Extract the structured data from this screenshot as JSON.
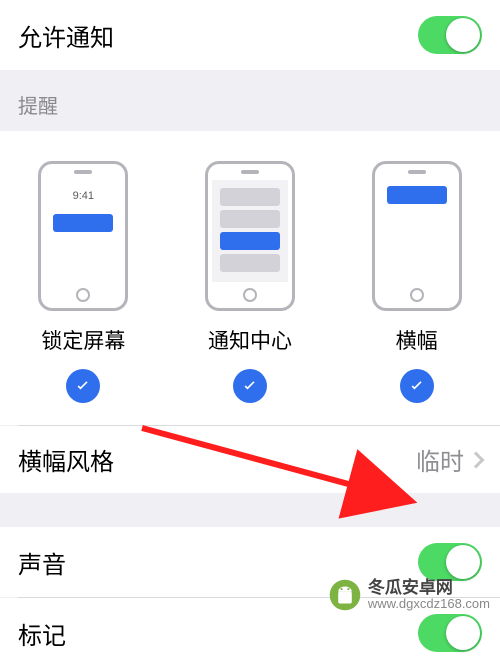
{
  "allow_notifications": {
    "label": "允许通知",
    "enabled": true
  },
  "alerts_header": "提醒",
  "previews": {
    "lock_screen": {
      "label": "锁定屏幕",
      "time": "9:41",
      "checked": true
    },
    "notification_center": {
      "label": "通知中心",
      "checked": true
    },
    "banners": {
      "label": "横幅",
      "checked": true
    }
  },
  "banner_style": {
    "label": "横幅风格",
    "value": "临时"
  },
  "sounds": {
    "label": "声音",
    "enabled": true
  },
  "badges": {
    "label": "标记",
    "enabled": true
  },
  "watermark": {
    "title": "冬瓜安卓网",
    "url": "www.dgxcdz168.com"
  }
}
